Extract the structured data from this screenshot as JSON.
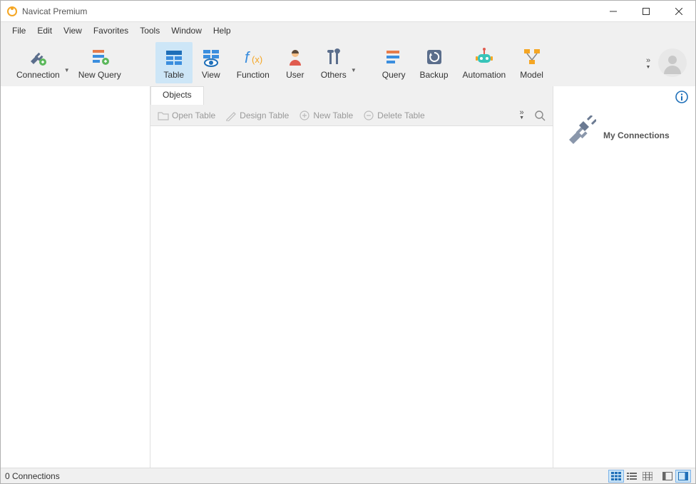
{
  "titlebar": {
    "title": "Navicat Premium"
  },
  "menubar": {
    "items": [
      "File",
      "Edit",
      "View",
      "Favorites",
      "Tools",
      "Window",
      "Help"
    ]
  },
  "toolbar": {
    "connection": "Connection",
    "newquery": "New Query",
    "table": "Table",
    "view": "View",
    "function": "Function",
    "user": "User",
    "others": "Others",
    "query": "Query",
    "backup": "Backup",
    "automation": "Automation",
    "model": "Model"
  },
  "center": {
    "tab": "Objects",
    "sub": {
      "open": "Open Table",
      "design": "Design Table",
      "new": "New Table",
      "delete": "Delete Table"
    }
  },
  "rightpane": {
    "label": "My Connections"
  },
  "statusbar": {
    "text": "0 Connections"
  }
}
